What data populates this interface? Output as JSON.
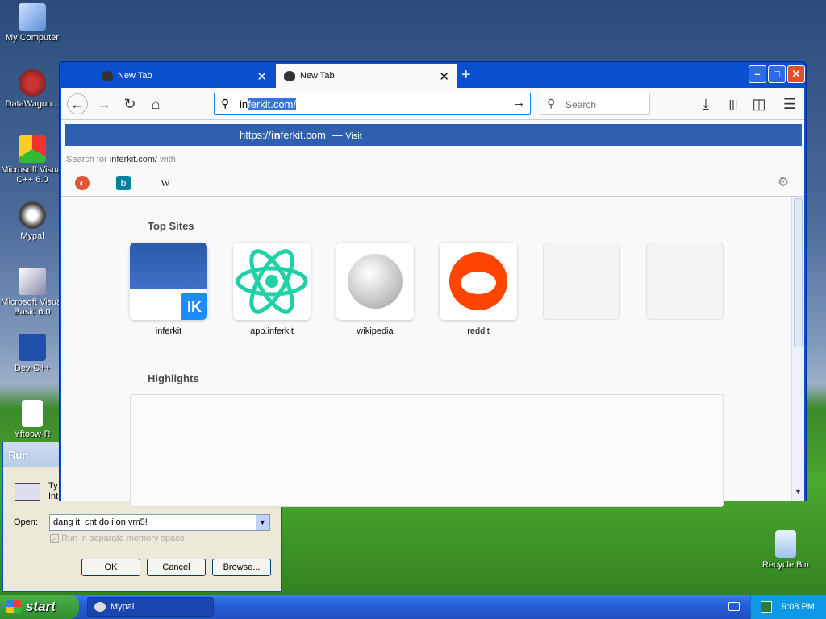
{
  "desktop_icons": [
    {
      "label": "My Computer",
      "icon": "computer-icon"
    },
    {
      "label": "DataWagon...",
      "icon": "datawagon-icon"
    },
    {
      "label": "Microsoft Visual C++ 6.0",
      "icon": "visual-cpp-icon"
    },
    {
      "label": "Mypal",
      "icon": "mypal-icon"
    },
    {
      "label": "Microsoft Visual Basic 6.0",
      "icon": "visual-basic-icon"
    },
    {
      "label": "Dev-C++",
      "icon": "dev-cpp-icon"
    },
    {
      "label": "Yftoow-R",
      "icon": "file-icon"
    },
    {
      "label": "Recycle Bin",
      "icon": "recycle-bin-icon"
    }
  ],
  "browser": {
    "tabs": [
      {
        "label": "New Tab"
      },
      {
        "label": "New Tab"
      }
    ],
    "new_tab": "+",
    "url_prefix": "in",
    "url_selected": "ferkit.com/",
    "search_placeholder": "Search",
    "suggestion_url_a": "https://",
    "suggestion_url_b": "in",
    "suggestion_url_c": "ferkit.com",
    "suggestion_dash": "—",
    "suggestion_action": "Visit",
    "search_for_a": "Search for ",
    "search_for_b": "inferkit.com/",
    "search_for_c": " with:",
    "engines": [
      "duckduckgo-icon",
      "bing-icon",
      "wikipedia-icon"
    ],
    "wiki_letter": "W",
    "top_sites_heading": "Top Sites",
    "top_sites": [
      {
        "label": "inferkit",
        "badge": "IK"
      },
      {
        "label": "app.inferkit"
      },
      {
        "label": "wikipedia"
      },
      {
        "label": "reddit"
      }
    ],
    "highlights_heading": "Highlights"
  },
  "run_dialog": {
    "title": "Run",
    "desc_partial_1": "Ty",
    "desc_partial_2": "Int",
    "open_label": "Open:",
    "open_value": "dang it. cnt do i on vm5!",
    "checkbox_label": "Run in separate memory space",
    "ok": "OK",
    "cancel": "Cancel",
    "browse": "Browse..."
  },
  "taskbar": {
    "start": "start",
    "task": "Mypal",
    "clock": "9:08 PM"
  },
  "colors": {
    "accent": "#0a84ff",
    "titlebar": "#0a4fd0",
    "suggestion": "#2f60b0"
  }
}
